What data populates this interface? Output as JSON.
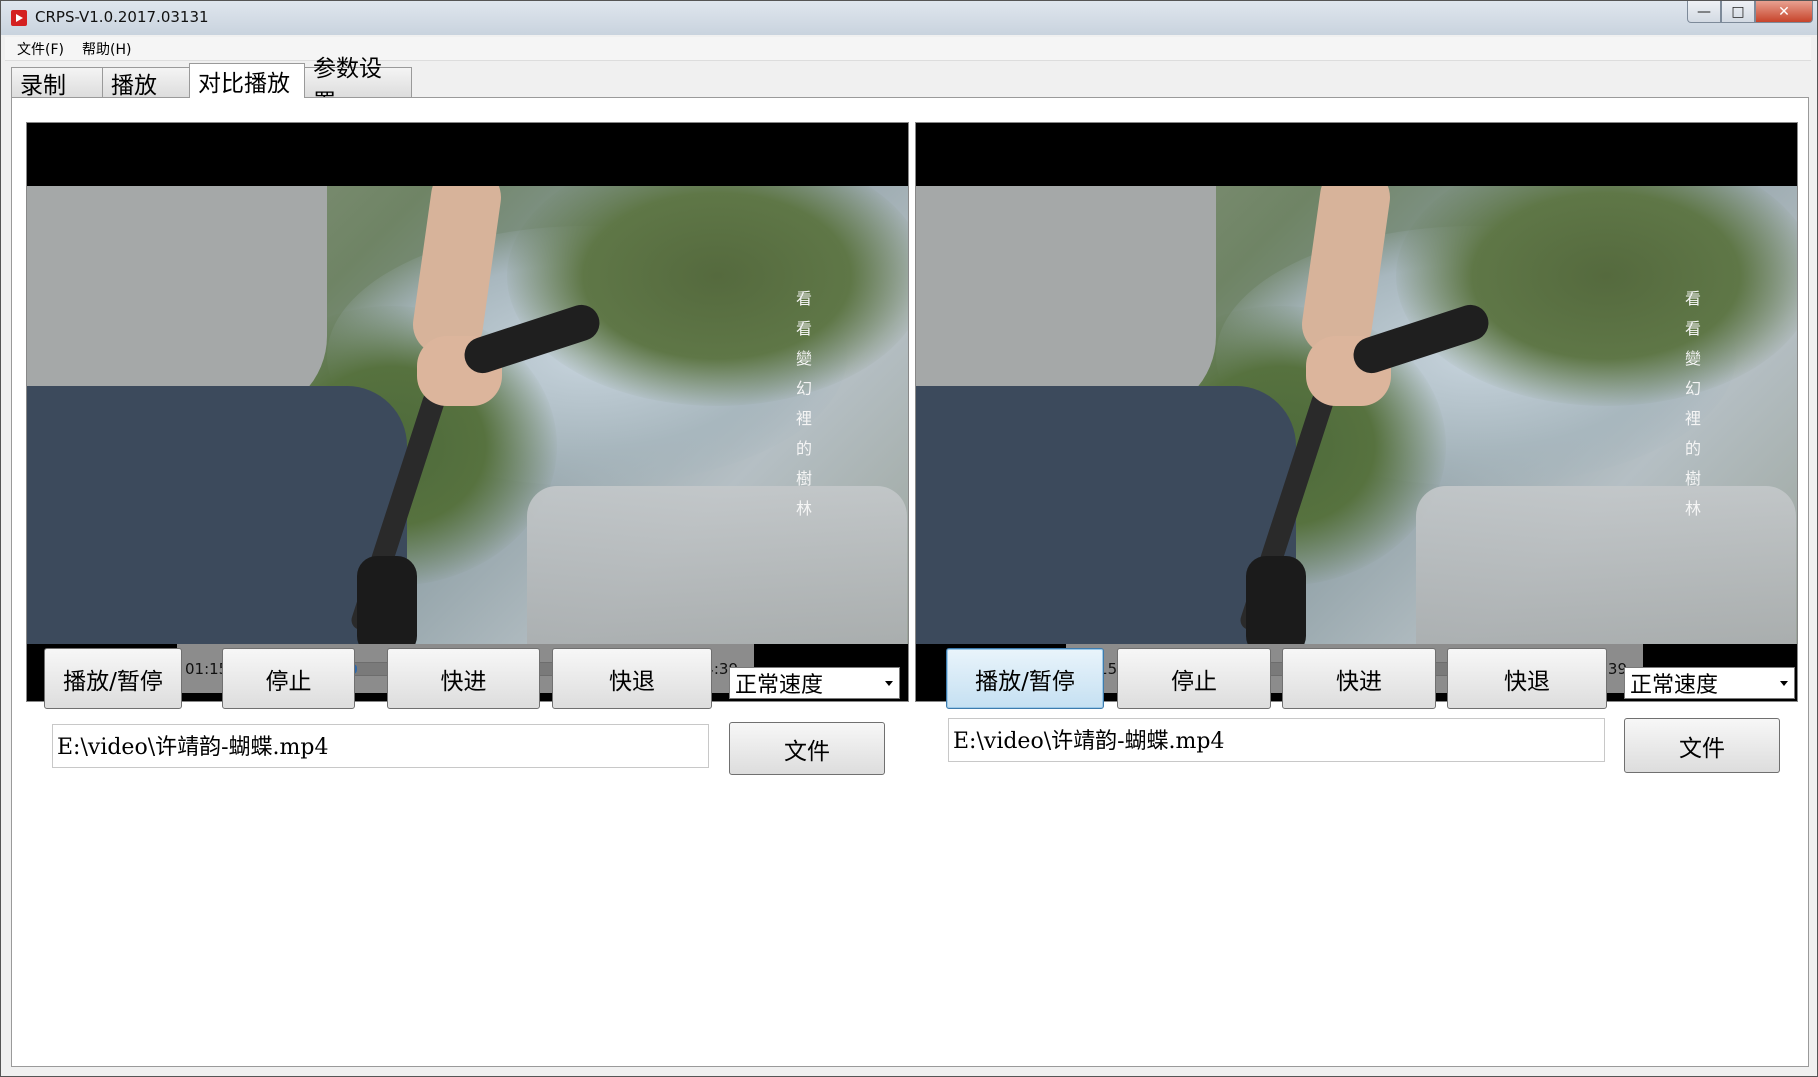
{
  "window": {
    "title": "CRPS-V1.0.2017.03131",
    "controls": {
      "minimize": "—",
      "maximize": "□",
      "close": "✕"
    }
  },
  "menu": [
    {
      "label": "文件(F)"
    },
    {
      "label": "帮助(H)"
    }
  ],
  "tabs": [
    {
      "label": "录制"
    },
    {
      "label": "播放"
    },
    {
      "label": "对比播放",
      "active": true
    },
    {
      "label": "参数设置"
    }
  ],
  "players": [
    {
      "overlay_lyrics": [
        "看",
        "看",
        "變",
        "幻",
        "裡",
        "的",
        "樹",
        "林"
      ],
      "current_time": "01:15",
      "duration": "04:39",
      "progress": 0.27,
      "buttons": {
        "play_pause": "播放/暂停",
        "stop": "停止",
        "forward": "快进",
        "rewind": "快退",
        "file": "文件"
      },
      "speed": "正常速度",
      "file_path": "E:\\video\\许靖韵-蝴蝶.mp4"
    },
    {
      "overlay_lyrics": [
        "看",
        "看",
        "變",
        "幻",
        "裡",
        "的",
        "樹",
        "林"
      ],
      "current_time": "01:15",
      "duration": "04:39",
      "progress": 0.27,
      "buttons": {
        "play_pause": "播放/暂停",
        "stop": "停止",
        "forward": "快进",
        "rewind": "快退",
        "file": "文件"
      },
      "speed": "正常速度",
      "file_path": "E:\\video\\许靖韵-蝴蝶.mp4"
    }
  ]
}
